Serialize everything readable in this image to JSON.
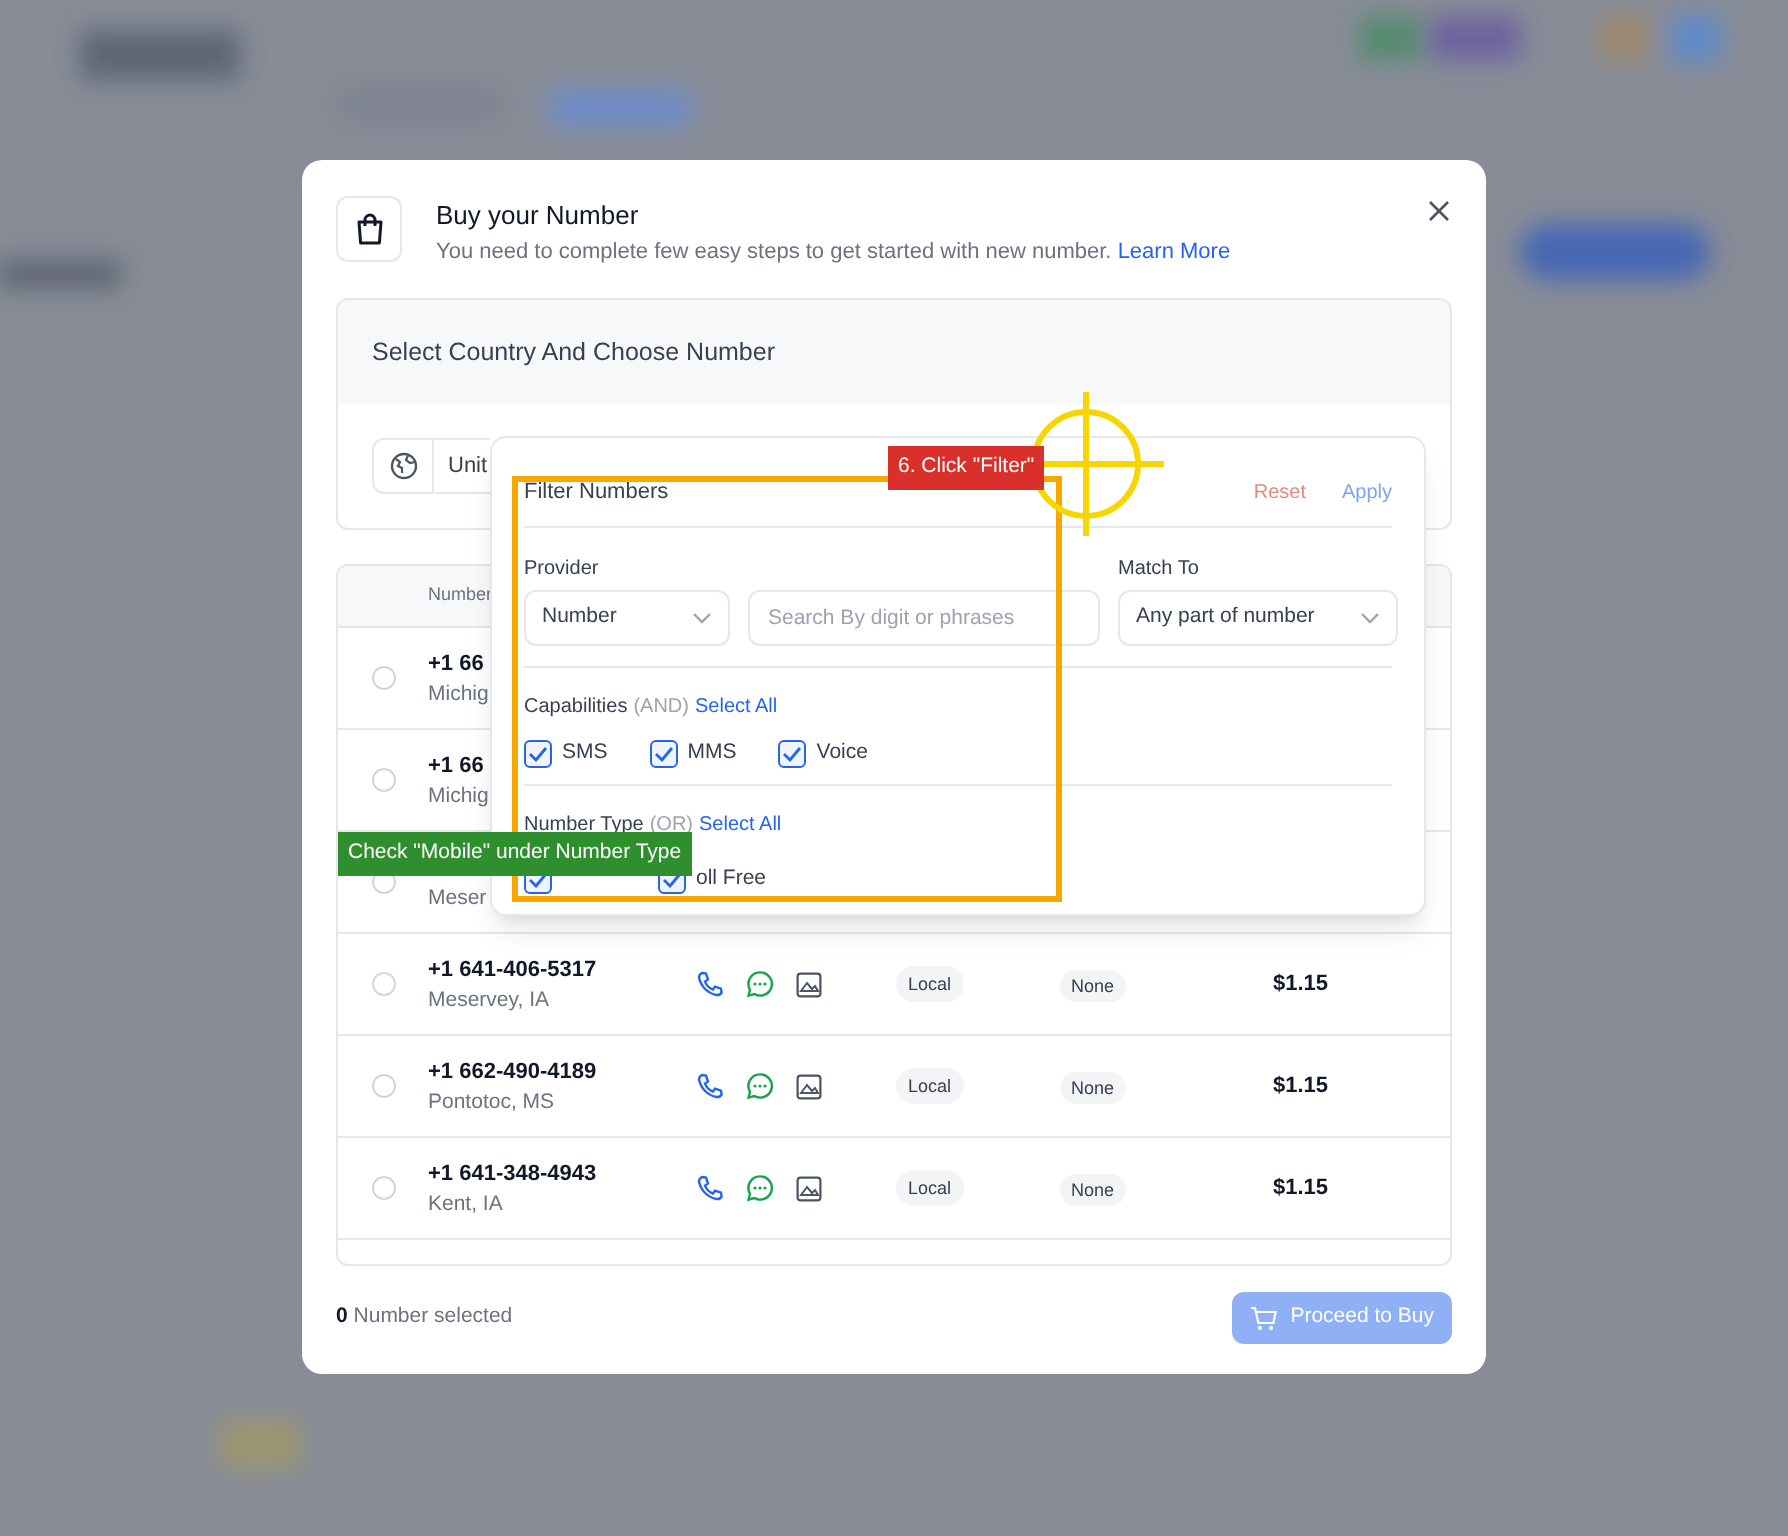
{
  "dialog": {
    "title": "Buy your Number",
    "subtitle": "You need to complete few easy steps to get started with new number.",
    "learn_more": "Learn More"
  },
  "country_card": {
    "title": "Select Country And Choose Number",
    "country": "Unit"
  },
  "table": {
    "columns": [
      "Number"
    ],
    "rows": [
      {
        "number": "+1 66",
        "location": "Michig",
        "selected": false
      },
      {
        "number": "+1 66",
        "location": "Michig",
        "selected": false
      },
      {
        "location": "Meser",
        "selected": false
      },
      {
        "number": "+1 641-406-5317",
        "location": "Meservey, IA",
        "type": "Local",
        "column_5": "None",
        "price": "$1.15",
        "selected": false
      },
      {
        "number": "+1 662-490-4189",
        "location": "Pontotoc, MS",
        "type": "Local",
        "column_5": "None",
        "price": "$1.15",
        "selected": false
      },
      {
        "number": "+1 641-348-4943",
        "location": "Kent, IA",
        "type": "Local",
        "column_5": "None",
        "price": "$1.15",
        "selected": false
      }
    ]
  },
  "footer": {
    "count": "0",
    "label": "Number selected",
    "button": "Proceed to Buy"
  },
  "filter": {
    "title": "Filter Numbers",
    "reset": "Reset",
    "apply": "Apply",
    "provider_label": "Provider",
    "provider": "Number",
    "search_placeholder": "Search By digit or phrases",
    "match_label": "Match To",
    "match": "Any part of number",
    "capabilities_label": "Capabilities",
    "capabilities_hint": "(AND)",
    "capabilities_select_all": "Select All",
    "capabilities": [
      {
        "label": "SMS",
        "checked": true
      },
      {
        "label": "MMS",
        "checked": true
      },
      {
        "label": "Voice",
        "checked": true
      }
    ],
    "type_label": "Number Type",
    "type_hint": "(OR)",
    "type_select_all": "Select All",
    "types": [
      {
        "checked": true
      },
      {
        "label": "oll Free",
        "checked": true
      }
    ]
  },
  "annotations": [
    {
      "kind": "step",
      "text": "6. Click \"Filter\""
    },
    {
      "kind": "hint",
      "text": "Check \"Mobile\" under Number Type"
    }
  ]
}
